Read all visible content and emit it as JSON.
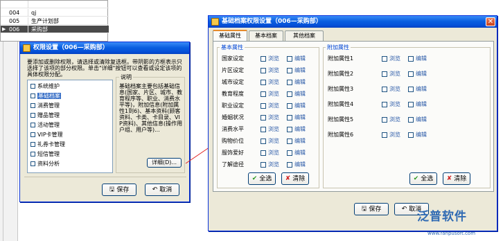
{
  "background_list": {
    "rows": [
      {
        "code": "",
        "name": "",
        "selected": false
      },
      {
        "code": "004",
        "name": "qj",
        "selected": false
      },
      {
        "code": "005",
        "name": "生产计划部",
        "selected": false
      },
      {
        "code": "006",
        "name": "采购部",
        "selected": true
      }
    ]
  },
  "perm_dialog": {
    "title": "权限设置（006—采购部）",
    "hint": "要添加或删除权限，请选择或清除复选框。带阴影的方框表示只选择了该项的部分权限。单击\"详细\"按钮可以查看或设定该项的具体权限分配。",
    "modules": [
      {
        "label": "系统维护",
        "selected": false
      },
      {
        "label": "基础档案",
        "selected": true
      },
      {
        "label": "消费管理",
        "selected": false
      },
      {
        "label": "赠品管理",
        "selected": false
      },
      {
        "label": "活动管理",
        "selected": false
      },
      {
        "label": "VIP卡管理",
        "selected": false
      },
      {
        "label": "礼券卡管理",
        "selected": false
      },
      {
        "label": "短信管理",
        "selected": false
      },
      {
        "label": "资料分析",
        "selected": false
      }
    ],
    "desc_title": "说明",
    "desc_text": "基础档案主要包括基础信息(国家、片区、城市、教育程序等、职业、消费水平等)，附加信息(附加属性1到6)、基本资料(顾客资料、卡类、卡目录、VIP资料)、其他信息(操作用户组、用户等)...",
    "detail_button": "详细(D)...",
    "save_button": "保存",
    "cancel_button": "取消"
  },
  "archive_dialog": {
    "title": "基础档案权限设置（006—采购部）",
    "tabs": [
      "基础属性",
      "基本档案",
      "其他档案"
    ],
    "basic_group_title": "基本属性",
    "extra_group_title": "附加属性",
    "browse_label": "浏览",
    "edit_label": "编辑",
    "basic_props": [
      "国家设定",
      "片区设定",
      "城市设定",
      "教育程度",
      "职业设定",
      "婚姻状况",
      "消费水平",
      "购物价位",
      "服饰爱好",
      "了解途径"
    ],
    "extra_props": [
      "附加属性1",
      "附加属性2",
      "附加属性3",
      "附加属性4",
      "附加属性5",
      "附加属性6"
    ],
    "select_all": "全选",
    "clear": "清除",
    "save_button": "保存",
    "cancel_button": "取消"
  },
  "watermark": {
    "brand": "泛普软件",
    "url": "www.fanpusoft.com"
  },
  "colors": {
    "title_blue": "#0a5fe0",
    "dialog_bg": "#ece9d8",
    "link_blue": "#2a5aa8",
    "selection": "#316ac5"
  }
}
